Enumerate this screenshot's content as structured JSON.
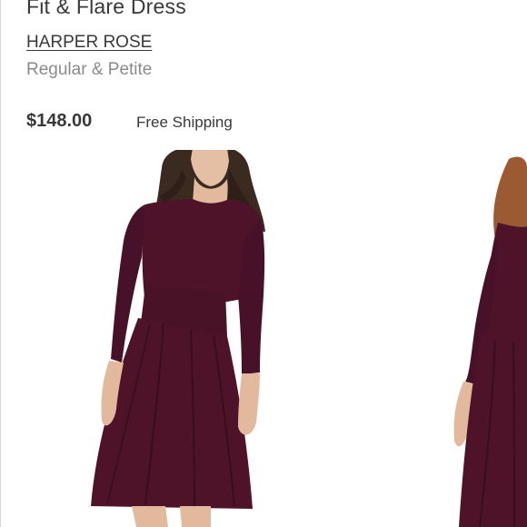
{
  "product": {
    "title": "Fit & Flare Dress",
    "brand": "HARPER ROSE",
    "size_range": "Regular & Petite",
    "price": "$148.00",
    "shipping": "Free Shipping"
  },
  "gallery": {
    "images": [
      "dress-front-image",
      "dress-side-image-partial"
    ]
  },
  "colors": {
    "dress": "#4e1328",
    "dress_shadow": "#3a0d1d",
    "skin": "#e8c2a8",
    "hair": "#3b2a20",
    "hair_auburn": "#9c5a32",
    "text": "#393939",
    "muted_text": "#8a8a8a"
  }
}
